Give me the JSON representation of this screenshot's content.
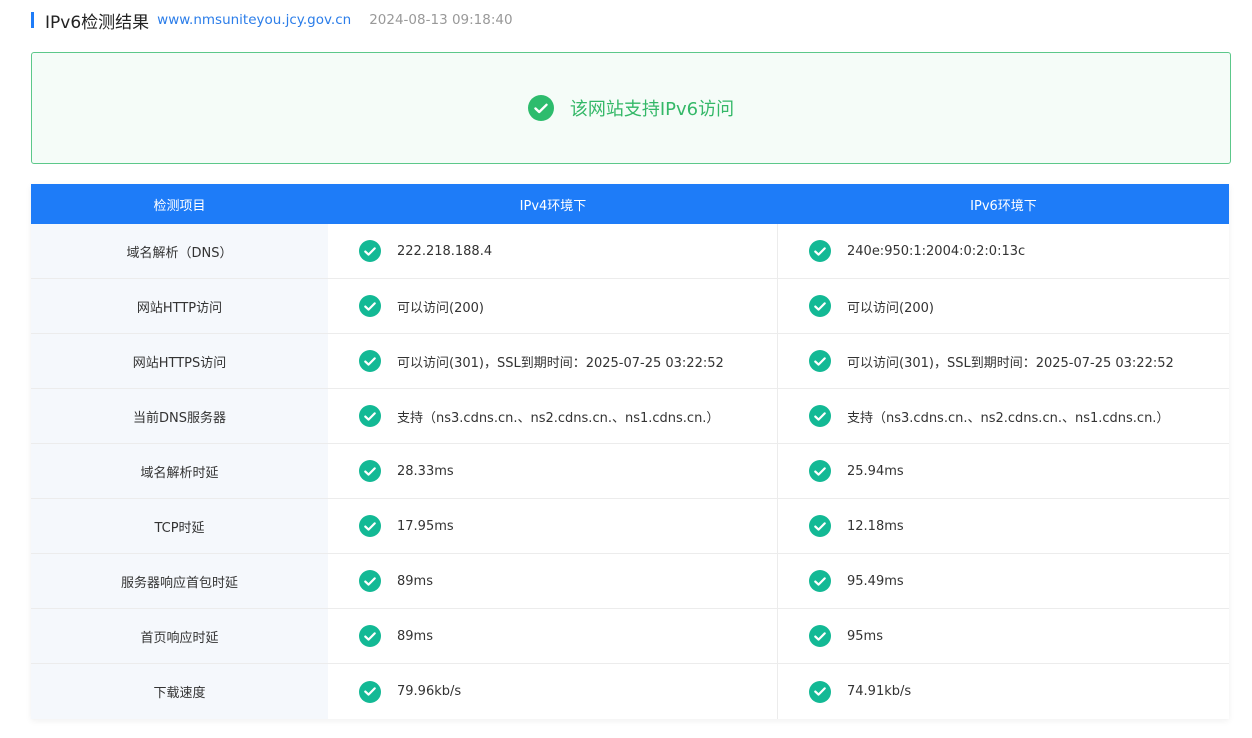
{
  "header": {
    "title": "IPv6检测结果",
    "domain": "www.nmsuniteyou.jcy.gov.cn",
    "datetime": "2024-08-13 09:18:40"
  },
  "banner": {
    "icon": "check-circle-icon",
    "text": "该网站支持IPv6访问"
  },
  "table": {
    "headers": [
      "检测项目",
      "IPv4环境下",
      "IPv6环境下"
    ],
    "rows": [
      {
        "label": "域名解析（DNS）",
        "ipv4": "222.218.188.4",
        "ipv6": "240e:950:1:2004:0:2:0:13c"
      },
      {
        "label": "网站HTTP访问",
        "ipv4": "可以访问(200)",
        "ipv6": "可以访问(200)"
      },
      {
        "label": "网站HTTPS访问",
        "ipv4": "可以访问(301)，SSL到期时间：2025-07-25 03:22:52",
        "ipv6": "可以访问(301)，SSL到期时间：2025-07-25 03:22:52"
      },
      {
        "label": "当前DNS服务器",
        "ipv4": "支持（ns3.cdns.cn.、ns2.cdns.cn.、ns1.cdns.cn.）",
        "ipv6": "支持（ns3.cdns.cn.、ns2.cdns.cn.、ns1.cdns.cn.）"
      },
      {
        "label": "域名解析时延",
        "ipv4": "28.33ms",
        "ipv6": "25.94ms"
      },
      {
        "label": "TCP时延",
        "ipv4": "17.95ms",
        "ipv6": "12.18ms"
      },
      {
        "label": "服务器响应首包时延",
        "ipv4": "89ms",
        "ipv6": "95.49ms"
      },
      {
        "label": "首页响应时延",
        "ipv4": "89ms",
        "ipv6": "95ms"
      },
      {
        "label": "下载速度",
        "ipv4": "79.96kb/s",
        "ipv6": "74.91kb/s"
      }
    ]
  },
  "colors": {
    "accent": "#1e7cf8",
    "success": "#2dbc6d",
    "check": "#13b995",
    "label_bg": "#f5f8fc"
  }
}
